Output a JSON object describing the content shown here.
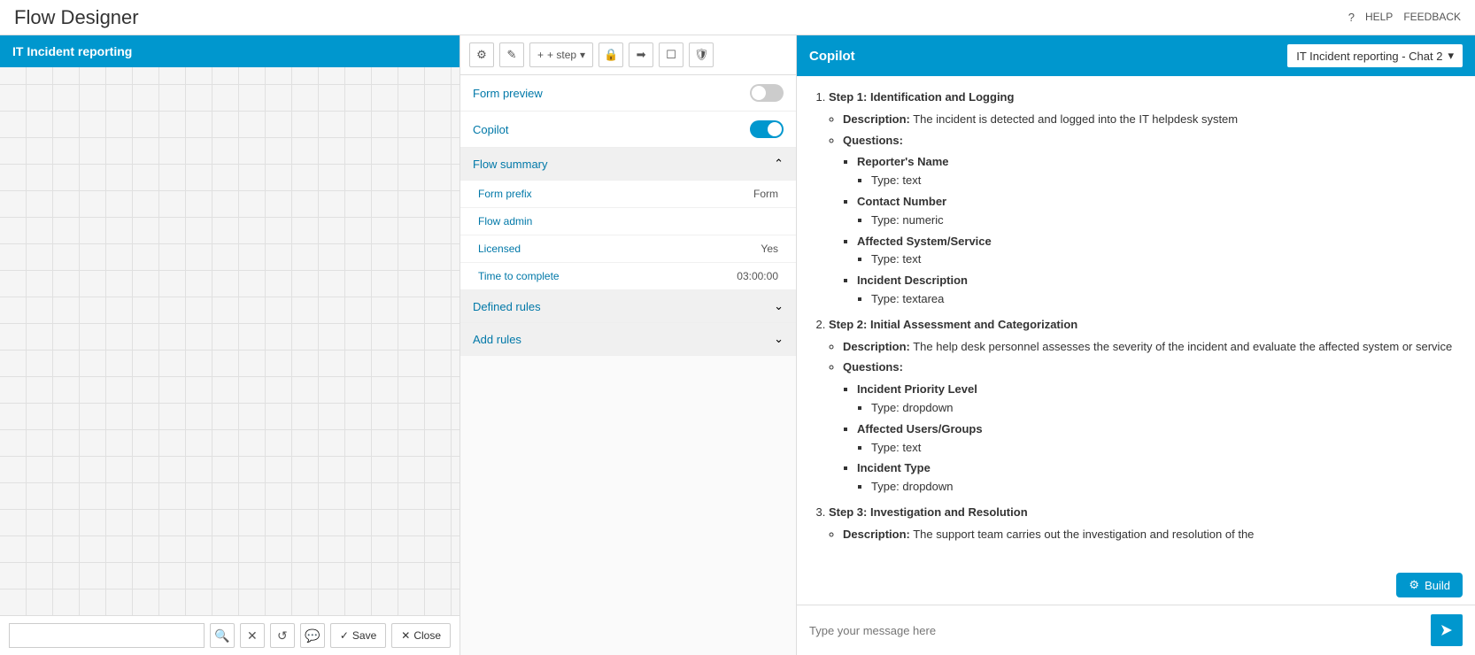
{
  "header": {
    "title": "Flow Designer",
    "help_label": "HELP",
    "feedback_label": "FEEDBACK",
    "help_icon": "?"
  },
  "left_panel": {
    "header_label": "IT Incident reporting",
    "footer": {
      "input_placeholder": "",
      "save_label": "Save",
      "close_label": "Close"
    }
  },
  "middle_panel": {
    "toolbar": {
      "step_label": "+ step"
    },
    "form_preview": {
      "label": "Form preview",
      "enabled": false
    },
    "copilot": {
      "label": "Copilot",
      "enabled": true
    },
    "flow_summary": {
      "label": "Flow summary",
      "expanded": true,
      "rows": [
        {
          "key": "Form prefix",
          "value": "Form"
        },
        {
          "key": "Flow admin",
          "value": ""
        },
        {
          "key": "Licensed",
          "value": "Yes"
        },
        {
          "key": "Time to complete",
          "value": "03:00:00"
        }
      ]
    },
    "defined_rules": {
      "label": "Defined rules",
      "expanded": false
    },
    "add_rules": {
      "label": "Add rules",
      "expanded": false
    }
  },
  "copilot_panel": {
    "title": "Copilot",
    "dropdown_label": "IT Incident reporting - Chat 2",
    "build_label": "Build",
    "input_placeholder": "Type your message here",
    "steps": [
      {
        "number": 1,
        "title": "Step 1: Identification and Logging",
        "description": "The incident is detected and logged into the IT helpdesk system",
        "questions": [
          {
            "name": "Reporter's Name",
            "type": "text"
          },
          {
            "name": "Contact Number",
            "type": "numeric"
          },
          {
            "name": "Affected System/Service",
            "type": "text"
          },
          {
            "name": "Incident Description",
            "type": "textarea"
          }
        ]
      },
      {
        "number": 2,
        "title": "Step 2: Initial Assessment and Categorization",
        "description": "The help desk personnel assesses the severity of the incident and evaluate the affected system or service",
        "questions": [
          {
            "name": "Incident Priority Level",
            "type": "dropdown"
          },
          {
            "name": "Affected Users/Groups",
            "type": "text"
          },
          {
            "name": "Incident Type",
            "type": "dropdown"
          }
        ]
      },
      {
        "number": 3,
        "title": "Step 3: Investigation and Resolution",
        "description": "The support team carries out the investigation and resolution of the",
        "questions": []
      }
    ]
  }
}
